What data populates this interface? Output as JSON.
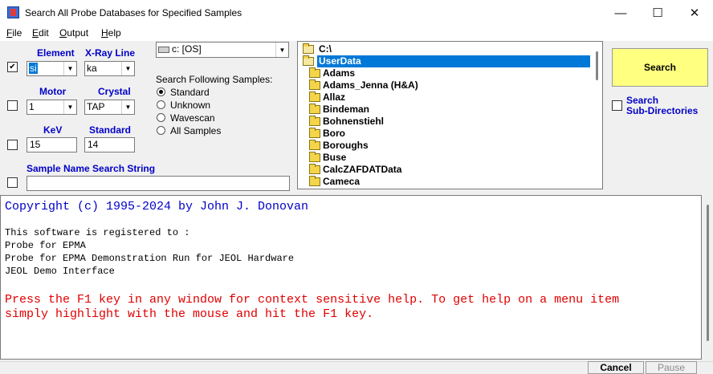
{
  "window": {
    "title": "Search All Probe Databases for Specified Samples",
    "minimize": "—",
    "maximize": "☐",
    "close": "✕"
  },
  "menu": {
    "file": "ile",
    "file_key": "F",
    "edit": "dit",
    "edit_key": "E",
    "output": "utput",
    "output_key": "O",
    "help": "elp",
    "help_key": "H"
  },
  "criteria": {
    "element_label": "Element",
    "element_value": "si",
    "element_checked": "✔",
    "xray_label": "X-Ray Line",
    "xray_value": "ka",
    "motor_label": "Motor",
    "motor_value": "1",
    "crystal_label": "Crystal",
    "crystal_value": "TAP",
    "kev_label": "KeV",
    "kev_value": "15",
    "standard_label": "Standard",
    "standard_value": "14",
    "sample_name_label": "Sample Name Search String",
    "sample_name_value": ""
  },
  "drive": {
    "value": "c: [OS]"
  },
  "sample_types": {
    "heading": "Search Following Samples:",
    "options": [
      "Standard",
      "Unknown",
      "Wavescan",
      "All Samples"
    ],
    "selected": "Standard"
  },
  "tree": {
    "root": "C:\\",
    "selected": "UserData",
    "folders": [
      "Adams",
      "Adams_Jenna (H&A)",
      "Allaz",
      "Bindeman",
      "Bohnenstiehl",
      "Boro",
      "Boroughs",
      "Buse",
      "CalcZAFDATData",
      "Cameca"
    ]
  },
  "actions": {
    "search_label": "Search",
    "subdir_label_1": "Search",
    "subdir_label_2": "Sub-Directories",
    "cancel_label": "Cancel",
    "pause_label": "Pause"
  },
  "log": {
    "copyright": "Copyright (c) 1995-2024 by John J. Donovan",
    "registered": "This software is registered to :",
    "line1": "Probe for EPMA",
    "line2": "Probe for EPMA Demonstration Run for JEOL Hardware",
    "line3": "JEOL Demo Interface",
    "help1": "Press the F1 key in any window for context sensitive help. To get help on a menu item",
    "help2": "simply highlight with the mouse and hit the F1 key."
  },
  "colors": {
    "label_blue": "#0000c8",
    "log_blue": "#0000c8",
    "log_red": "#e00000",
    "search_yellow": "#ffff80",
    "selection": "#0078d7"
  }
}
